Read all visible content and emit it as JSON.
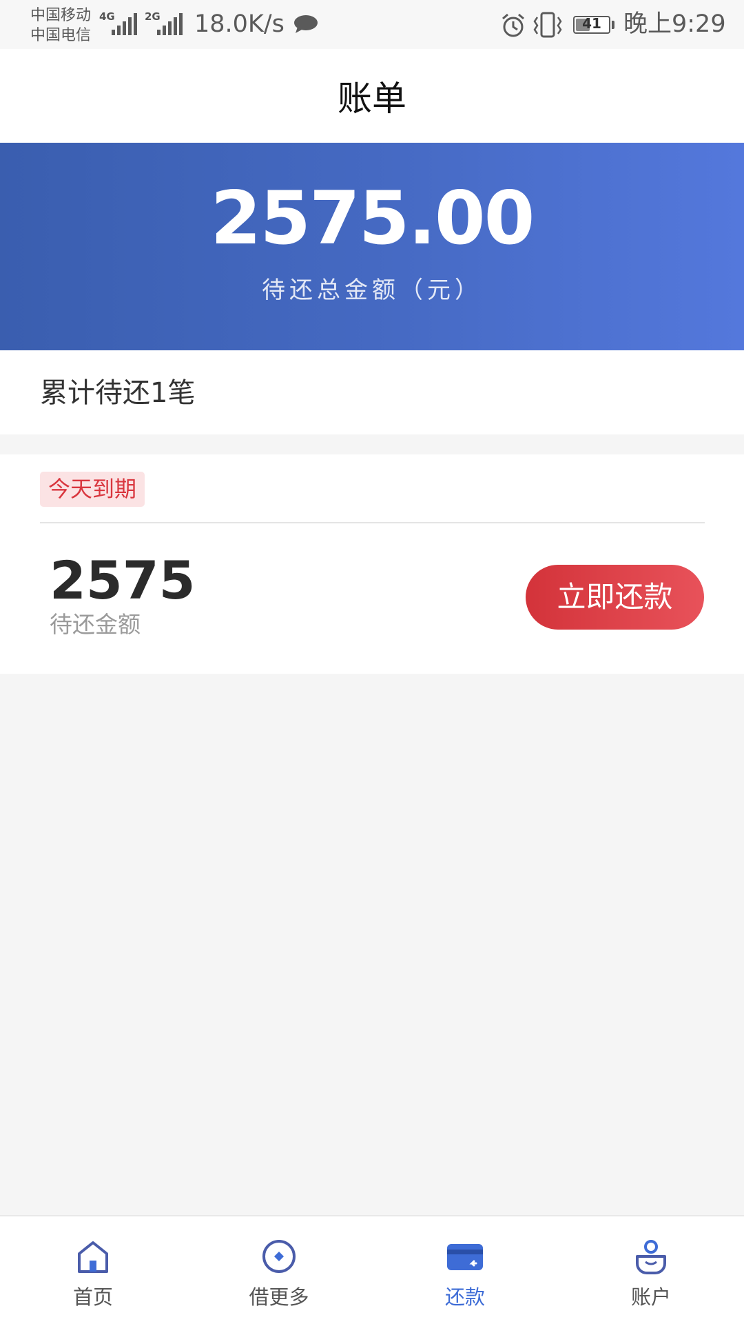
{
  "status_bar": {
    "carrier_1": "中国移动",
    "carrier_2": "中国电信",
    "network_1": "4G",
    "network_2": "2G",
    "net_speed": "18.0K/s",
    "battery_level": "41",
    "time": "晚上9:29",
    "icons": [
      "chat-icon",
      "alarm-icon",
      "vibrate-icon",
      "battery-icon"
    ]
  },
  "header": {
    "title": "账单"
  },
  "banner": {
    "amount": "2575.00",
    "amount_label": "待还总金额（元）"
  },
  "summary": {
    "count_text": "累计待还1笔"
  },
  "bill": {
    "due_badge": "今天到期",
    "amount": "2575",
    "amount_label": "待还金额",
    "repay_button": "立即还款"
  },
  "bottom_nav": {
    "items": [
      {
        "label": "首页",
        "icon": "home-icon",
        "active": false
      },
      {
        "label": "借更多",
        "icon": "compass-icon",
        "active": false
      },
      {
        "label": "还款",
        "icon": "card-icon",
        "active": true
      },
      {
        "label": "账户",
        "icon": "user-icon",
        "active": false
      }
    ]
  },
  "colors": {
    "banner_start": "#3a5eaf",
    "banner_end": "#5478dc",
    "accent_red": "#d9363e",
    "nav_active": "#3e6cd6",
    "nav_icon": "#4a5caa"
  }
}
